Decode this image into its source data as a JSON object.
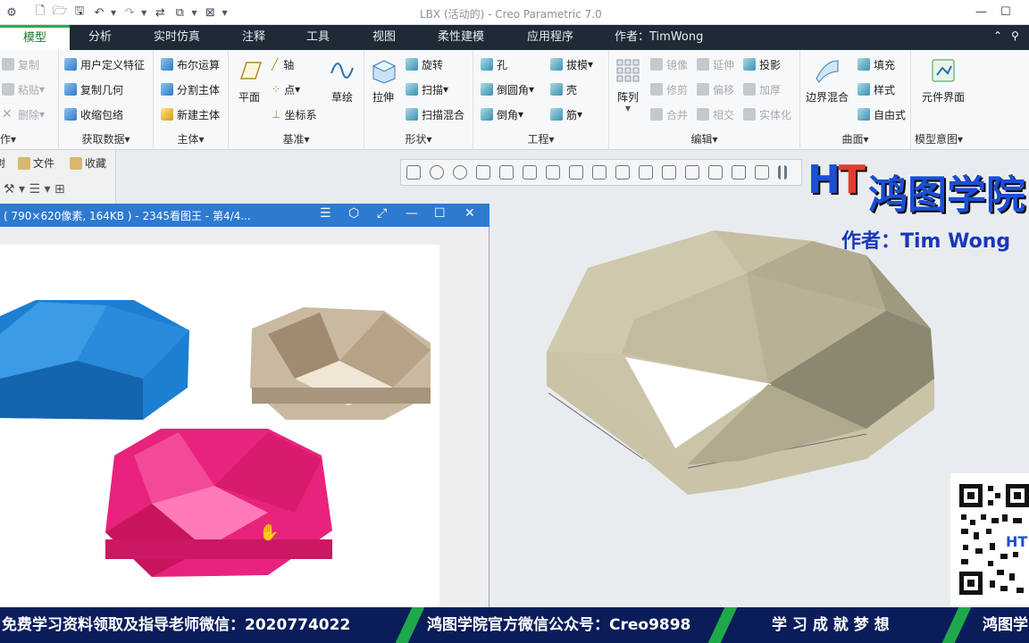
{
  "window": {
    "title": "LBX (活动的) - Creo Parametric 7.0"
  },
  "ribbon_tabs": [
    {
      "label": "模型",
      "active": true
    },
    {
      "label": "分析"
    },
    {
      "label": "实时仿真"
    },
    {
      "label": "注释"
    },
    {
      "label": "工具"
    },
    {
      "label": "视图"
    },
    {
      "label": "柔性建模"
    },
    {
      "label": "应用程序"
    }
  ],
  "author_tab": "作者：TimWong",
  "ribbon": {
    "operations": {
      "copy": "复制",
      "paste": "粘贴",
      "delete": "删除",
      "label": "作▾"
    },
    "get_data": {
      "udf": "用户定义特征",
      "copy_geom": "复制几何",
      "shrinkwrap": "收缩包络",
      "label": "获取数据▾"
    },
    "body": {
      "boolean": "布尔运算",
      "split": "分割主体",
      "new": "新建主体",
      "label": "主体▾"
    },
    "datum": {
      "plane": "平面",
      "axis": "轴",
      "point": "点",
      "csys": "坐标系",
      "sketch": "草绘",
      "label": "基准▾"
    },
    "shapes": {
      "extrude": "拉伸",
      "revolve": "旋转",
      "sweep": "扫描",
      "swept_blend": "扫描混合",
      "label": "形状▾"
    },
    "engineering": {
      "hole": "孔",
      "round": "倒圆角",
      "chamfer": "倒角",
      "draft": "拔模",
      "shell": "壳",
      "rib": "筋",
      "label": "工程▾"
    },
    "editing": {
      "pattern": "阵列",
      "mirror": "镜像",
      "trim": "修剪",
      "merge": "合并",
      "extend": "延伸",
      "offset": "偏移",
      "intersect": "相交",
      "project": "投影",
      "thicken": "加厚",
      "solidify": "实体化",
      "label": "编辑▾"
    },
    "surfaces": {
      "boundary_blend": "边界混合",
      "fill": "填充",
      "style": "样式",
      "freeform": "自由式",
      "label": "曲面▾"
    },
    "model_intent": {
      "component_interface": "元件界面",
      "label": "模型意图▾"
    }
  },
  "left_panel": {
    "tab_1": "树",
    "tab_2": "文件",
    "tab_3": "收藏"
  },
  "image_viewer": {
    "title": "( 790×620像素, 164KB ) - 2345看图王 - 第4/4..."
  },
  "overlay": {
    "logo_mark": "HT",
    "logo_text": "鸿图学院",
    "author": "作者：Tim Wong"
  },
  "banner": {
    "seg1": "免费学习资料领取及指导老师微信：2020774022",
    "seg2": "鸿图学院官方微信公众号：Creo9898",
    "seg3": "学 习 成 就 梦 想",
    "seg4": "鸿图学"
  }
}
